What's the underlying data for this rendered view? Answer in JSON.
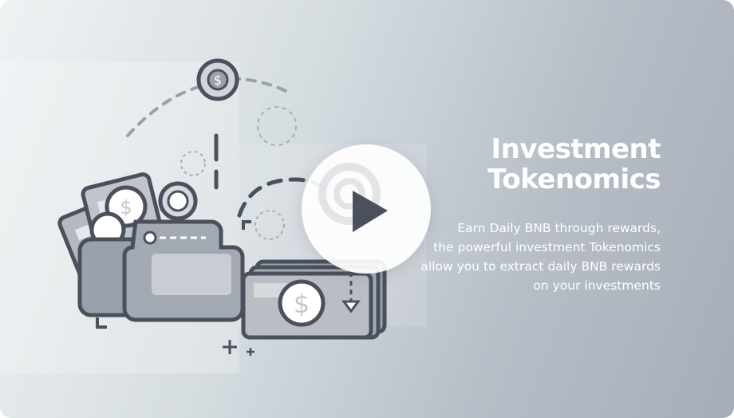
{
  "card": {
    "title_line1": "Investment",
    "title_line2": "Tokenomics",
    "description_lines": [
      "Earn Daily BNB through rewards,",
      "the powerful investment Tokenomics",
      "allow you to extract daily BNB rewards",
      "on your investments"
    ]
  },
  "icons": {
    "play": "play-icon",
    "illustration": "wallet-coins-illustration"
  },
  "colors": {
    "text": "#ffffff",
    "stroke": "#4a505c",
    "fill_mid": "#9ba1ac",
    "fill_light": "#c8ccd3"
  }
}
